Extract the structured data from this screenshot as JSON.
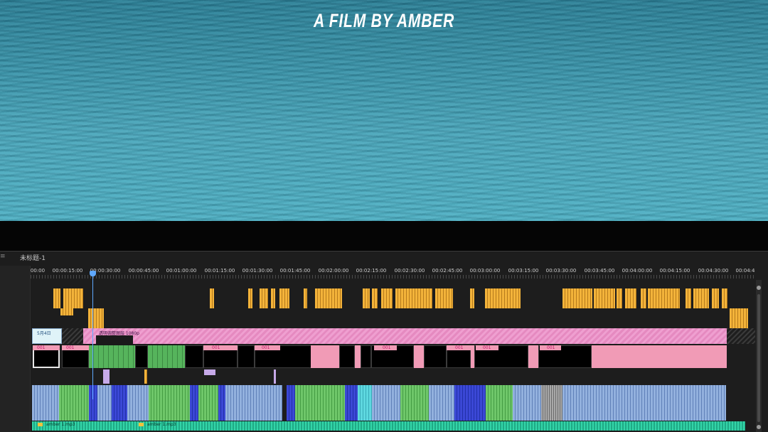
{
  "preview": {
    "title_text": "A FILM BY AMBER"
  },
  "timeline": {
    "sequence_name": "未标题-1",
    "close_glyph": "≡",
    "ruler_labels": [
      "00:00",
      "00:00:15:00",
      "00:00:30:00",
      "00:00:45:00",
      "00:01:00:00",
      "00:01:15:00",
      "00:01:30:00",
      "00:01:45:00",
      "00:02:00:00",
      "00:02:15:00",
      "00:02:30:00",
      "00:02:45:00",
      "00:03:00:00",
      "00:03:15:00",
      "00:03:30:00",
      "00:03:45:00",
      "00:04:00:00",
      "00:04:15:00",
      "00:04:30:00",
      "00:04:4"
    ],
    "pink_clip_label": "透明调整图层 1080p",
    "title_clip_label": "5月4日",
    "clip_labels": [
      "001",
      "001",
      "001",
      "001",
      "001",
      "001",
      "001",
      "001"
    ],
    "music_clips": [
      "amber 1.mp3",
      "amber 1.mp3"
    ]
  },
  "colors": {
    "accent_playhead": "#5fa8ff",
    "clip_yellow": "#f3b33a",
    "clip_pink": "#ef9fd0",
    "clip_green": "#56b45c",
    "audio_music": "#33d4a8"
  }
}
